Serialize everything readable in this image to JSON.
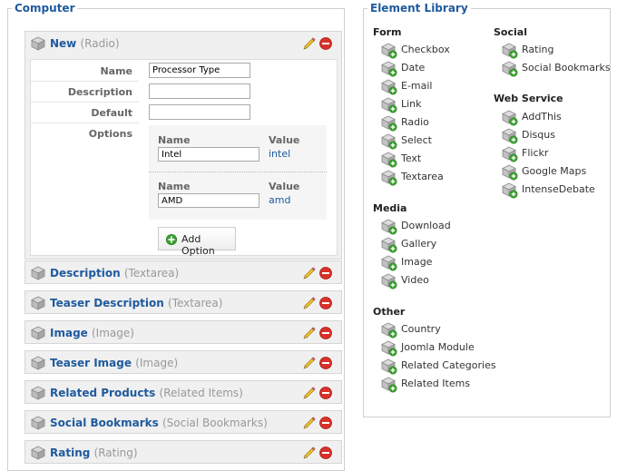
{
  "computer": {
    "legend": "Computer",
    "new_element": {
      "title": "New",
      "type": "(Radio)",
      "fields": {
        "name_label": "Name",
        "name_value": "Processor Type",
        "description_label": "Description",
        "description_value": "",
        "default_label": "Default",
        "default_value": "",
        "options_label": "Options"
      },
      "options": [
        {
          "name_label": "Name",
          "value_label": "Value",
          "name": "Intel",
          "value": "intel"
        },
        {
          "name_label": "Name",
          "value_label": "Value",
          "name": "AMD",
          "value": "amd"
        }
      ],
      "add_option_label": "Add Option"
    },
    "elements": [
      {
        "title": "Description",
        "type": "(Textarea)"
      },
      {
        "title": "Teaser Description",
        "type": "(Textarea)"
      },
      {
        "title": "Image",
        "type": "(Image)"
      },
      {
        "title": "Teaser Image",
        "type": "(Image)"
      },
      {
        "title": "Related Products",
        "type": "(Related Items)"
      },
      {
        "title": "Social Bookmarks",
        "type": "(Social Bookmarks)"
      },
      {
        "title": "Rating",
        "type": "(Rating)"
      }
    ]
  },
  "library": {
    "legend": "Element Library",
    "groups": {
      "form": {
        "title": "Form",
        "items": [
          "Checkbox",
          "Date",
          "E-mail",
          "Link",
          "Radio",
          "Select",
          "Text",
          "Textarea"
        ]
      },
      "media": {
        "title": "Media",
        "items": [
          "Download",
          "Gallery",
          "Image",
          "Video"
        ]
      },
      "other": {
        "title": "Other",
        "items": [
          "Country",
          "Joomla Module",
          "Related Categories",
          "Related Items"
        ]
      },
      "social": {
        "title": "Social",
        "items": [
          "Rating",
          "Social Bookmarks"
        ]
      },
      "web_service": {
        "title": "Web Service",
        "items": [
          "AddThis",
          "Disqus",
          "Flickr",
          "Google Maps",
          "IntenseDebate"
        ]
      }
    }
  },
  "icons": {
    "element": "cube-icon",
    "edit": "pencil-icon",
    "delete": "delete-icon",
    "add": "add-icon",
    "library_item": "cube-add-icon"
  },
  "colors": {
    "accent": "#1f5a9e",
    "delete": "#d9302a",
    "add": "#3aa02e",
    "panel_bg": "#f0f0f0"
  }
}
